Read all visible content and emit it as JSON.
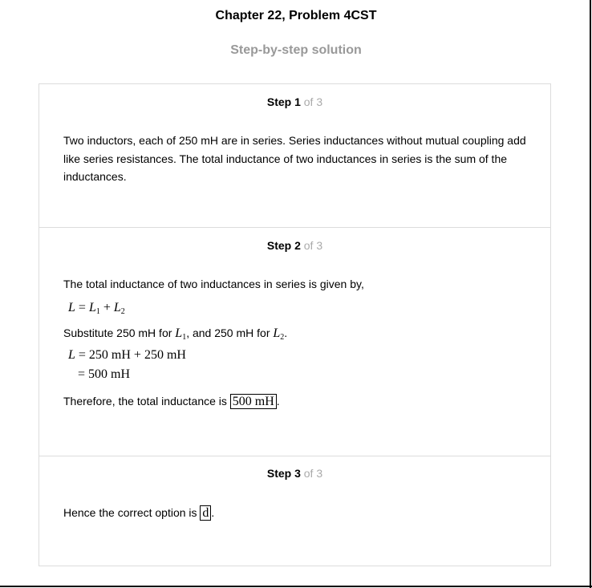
{
  "header": {
    "title": "Chapter 22, Problem 4CST",
    "subtitle": "Step-by-step solution"
  },
  "steps": [
    {
      "label": "Step 1",
      "of": "of 3",
      "text": "Two inductors, each of 250 mH are in series. Series inductances without mutual coupling add like series resistances. The total inductance of two inductances in series is the sum of the inductances."
    },
    {
      "label": "Step 2",
      "of": "of 3",
      "intro": "The total inductance of two inductances in series is given by,",
      "eq1": {
        "lhs": "L",
        "eq": " = ",
        "a": "L",
        "a_sub": "1",
        "plus": " + ",
        "b": "L",
        "b_sub": "2"
      },
      "substitute_text_1": "Substitute 250 mH for",
      "substitute_sym_1": "L",
      "substitute_sub_1": "1",
      "substitute_text_2": ", and 250 mH for",
      "substitute_sym_2": "L",
      "substitute_sub_2": "2",
      "substitute_end": ".",
      "eq2_line1": {
        "lhs": "L",
        "rhs": " = 250 mH + 250 mH"
      },
      "eq2_line2": "= 500 mH",
      "conclusion_text": "Therefore, the total inductance is",
      "conclusion_value": "500 mH",
      "conclusion_end": "."
    },
    {
      "label": "Step 3",
      "of": "of 3",
      "text": "Hence the correct option is",
      "answer": "d",
      "end": "."
    }
  ]
}
